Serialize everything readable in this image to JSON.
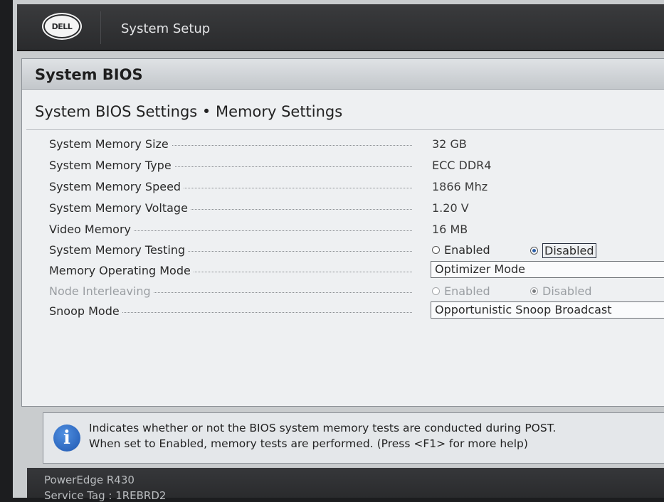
{
  "header": {
    "logo_text": "DELL",
    "title": "System Setup"
  },
  "panel": {
    "title": "System BIOS",
    "section_title": "System BIOS Settings • Memory Settings"
  },
  "settings": [
    {
      "label": "System Memory Size",
      "value": "32 GB"
    },
    {
      "label": "System Memory Type",
      "value": "ECC DDR4"
    },
    {
      "label": "System Memory Speed",
      "value": "1866 Mhz"
    },
    {
      "label": "System Memory Voltage",
      "value": "1.20 V"
    },
    {
      "label": "Video Memory",
      "value": "16 MB"
    },
    {
      "label": "System Memory Testing",
      "options": [
        "Enabled",
        "Disabled"
      ],
      "selected": "Disabled"
    },
    {
      "label": "Memory Operating Mode",
      "value": "Optimizer Mode"
    },
    {
      "label": "Node Interleaving",
      "options": [
        "Enabled",
        "Disabled"
      ],
      "selected": "Disabled",
      "disabled": true
    },
    {
      "label": "Snoop Mode",
      "value": "Opportunistic Snoop Broadcast"
    }
  ],
  "help": {
    "icon": "info-icon",
    "line1": "Indicates whether or not the BIOS system memory tests are conducted during POST.",
    "line2": "When set to Enabled, memory tests are performed. (Press <F1> for more help)"
  },
  "footer": {
    "model": "PowerEdge R430",
    "service_tag": "Service Tag : 1REBRD2"
  },
  "colors": {
    "header_bg": "#2a2b2d",
    "panel_bg": "#eef0f2",
    "radio_selected": "#2c5fa8",
    "info_icon": "#1e56b0"
  }
}
